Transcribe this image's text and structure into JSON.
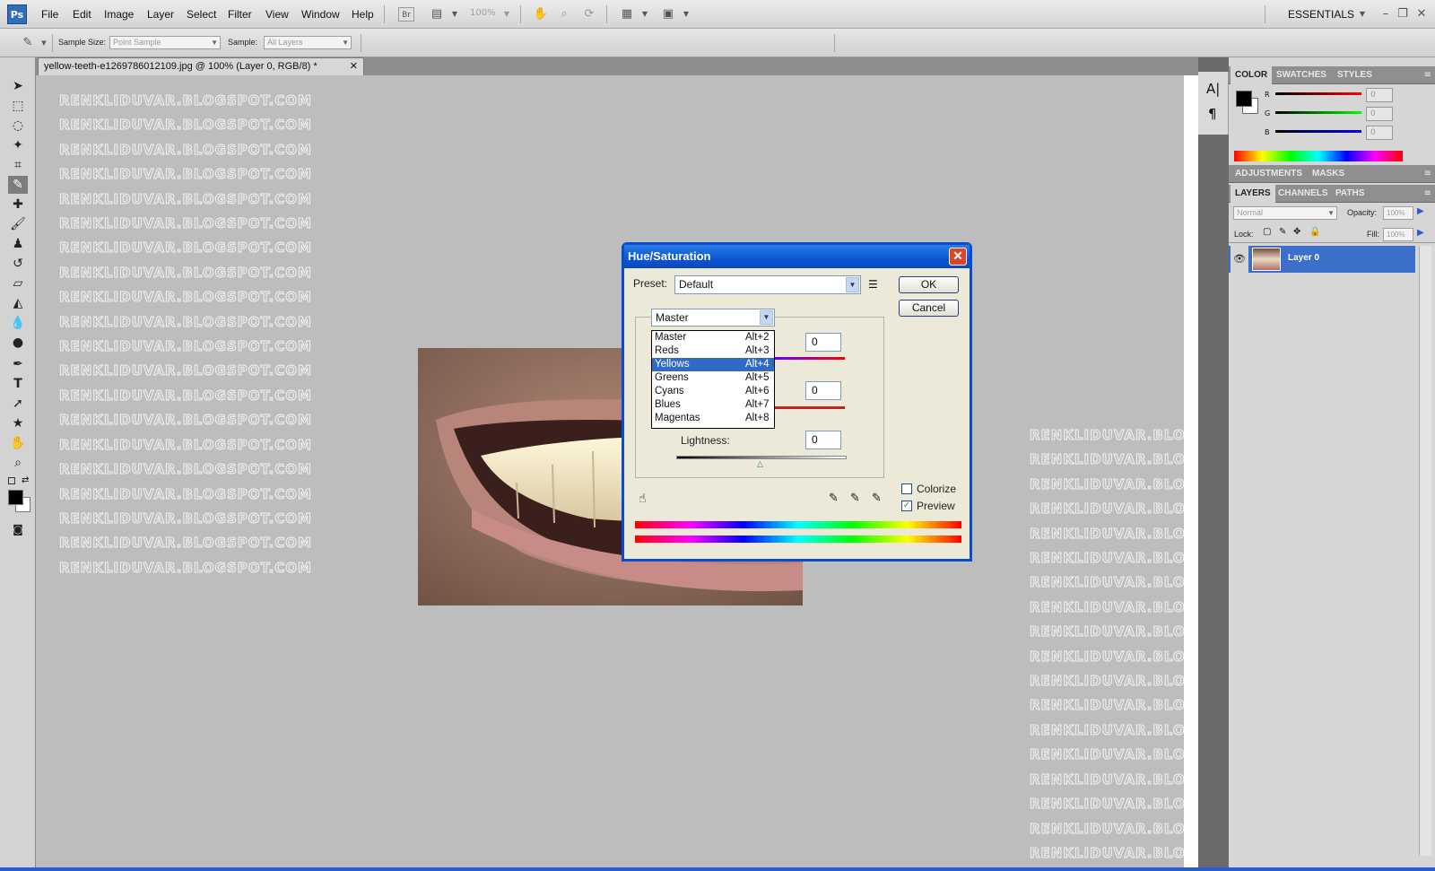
{
  "app": {
    "logo": "Ps"
  },
  "menu": [
    "File",
    "Edit",
    "Image",
    "Layer",
    "Select",
    "Filter",
    "View",
    "Window",
    "Help"
  ],
  "topbar": {
    "bridge": "Br",
    "zoom": "100%",
    "workspace": "ESSENTIALS"
  },
  "options": {
    "sample_size_label": "Sample Size:",
    "sample_size_value": "Point Sample",
    "sample_label": "Sample:",
    "sample_value": "All Layers"
  },
  "document": {
    "tab_title": "yellow-teeth-e1269786012109.jpg @ 100% (Layer 0, RGB/8) *",
    "watermark": "RENKLIDUVAR.BLOGSPOT.COM"
  },
  "color_panel": {
    "tabs": [
      "COLOR",
      "SWATCHES",
      "STYLES"
    ],
    "channels": [
      {
        "label": "R",
        "value": "0",
        "color": "#d01010"
      },
      {
        "label": "G",
        "value": "0",
        "color": "#10b010"
      },
      {
        "label": "B",
        "value": "0",
        "color": "#1010d0"
      }
    ]
  },
  "adjust_panel": {
    "tabs": [
      "ADJUSTMENTS",
      "MASKS"
    ]
  },
  "layers_panel": {
    "tabs": [
      "LAYERS",
      "CHANNELS",
      "PATHS"
    ],
    "blend_mode": "Normal",
    "opacity_label": "Opacity:",
    "opacity_value": "100%",
    "lock_label": "Lock:",
    "fill_label": "Fill:",
    "fill_value": "100%",
    "layer_name": "Layer 0"
  },
  "dialog": {
    "title": "Hue/Saturation",
    "preset_label": "Preset:",
    "preset_value": "Default",
    "ok": "OK",
    "cancel": "Cancel",
    "edit_value": "Master",
    "hue_value": "0",
    "saturation_value": "0",
    "lightness_label": "Lightness:",
    "lightness_value": "0",
    "colorize_label": "Colorize",
    "colorize_checked": false,
    "preview_label": "Preview",
    "preview_checked": true,
    "dropdown_items": [
      {
        "label": "Master",
        "shortcut": "Alt+2"
      },
      {
        "label": "Reds",
        "shortcut": "Alt+3"
      },
      {
        "label": "Yellows",
        "shortcut": "Alt+4",
        "selected": true
      },
      {
        "label": "Greens",
        "shortcut": "Alt+5"
      },
      {
        "label": "Cyans",
        "shortcut": "Alt+6"
      },
      {
        "label": "Blues",
        "shortcut": "Alt+7"
      },
      {
        "label": "Magentas",
        "shortcut": "Alt+8"
      }
    ]
  },
  "colors": {
    "accent": "#316ac5",
    "dialog_title": "#0a55d6",
    "layer_selected": "#3b6fc9"
  }
}
